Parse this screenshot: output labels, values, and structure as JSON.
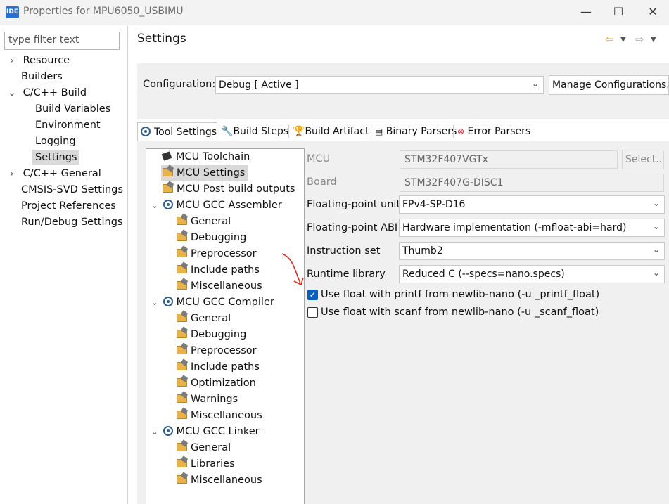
{
  "window": {
    "title": "Properties for MPU6050_USBIMU",
    "app_icon": "IDE",
    "minimize": "—",
    "maximize": "☐",
    "close": "✕"
  },
  "nav": {
    "filter_placeholder": "type filter text",
    "items": [
      {
        "label": "Resource"
      },
      {
        "label": "Builders"
      },
      {
        "label": "C/C++ Build"
      },
      {
        "label": "Build Variables"
      },
      {
        "label": "Environment"
      },
      {
        "label": "Logging"
      },
      {
        "label": "Settings"
      },
      {
        "label": "C/C++ General"
      },
      {
        "label": "CMSIS-SVD Settings"
      },
      {
        "label": "Project References"
      },
      {
        "label": "Run/Debug Settings"
      }
    ]
  },
  "page": {
    "title": "Settings"
  },
  "config": {
    "label": "Configuration:",
    "value": "Debug  [ Active ]",
    "manage_button": "Manage Configurations..."
  },
  "tabs": [
    "Tool Settings",
    "Build Steps",
    "Build Artifact",
    "Binary Parsers",
    "Error Parsers"
  ],
  "tree": {
    "toolchain": "MCU Toolchain",
    "mcu_settings": "MCU Settings",
    "post_build": "MCU Post build outputs",
    "assembler": {
      "label": "MCU GCC Assembler",
      "children": [
        "General",
        "Debugging",
        "Preprocessor",
        "Include paths",
        "Miscellaneous"
      ]
    },
    "compiler": {
      "label": "MCU GCC Compiler",
      "children": [
        "General",
        "Debugging",
        "Preprocessor",
        "Include paths",
        "Optimization",
        "Warnings",
        "Miscellaneous"
      ]
    },
    "linker": {
      "label": "MCU GCC Linker",
      "children": [
        "General",
        "Libraries",
        "Miscellaneous"
      ]
    }
  },
  "form": {
    "mcu_label": "MCU",
    "mcu_value": "STM32F407VGTx",
    "select_button": "Select...",
    "board_label": "Board",
    "board_value": "STM32F407G-DISC1",
    "fpu_label": "Floating-point unit",
    "fpu_value": "FPv4-SP-D16",
    "abi_label": "Floating-point ABI",
    "abi_value": "Hardware implementation (-mfloat-abi=hard)",
    "iset_label": "Instruction set",
    "iset_value": "Thumb2",
    "runtime_label": "Runtime library",
    "runtime_value": "Reduced C (--specs=nano.specs)",
    "printf_label": "Use float with printf from newlib-nano (-u _printf_float)",
    "printf_checked": true,
    "scanf_label": "Use float with scanf from newlib-nano (-u _scanf_float)",
    "scanf_checked": false
  },
  "colors": {
    "accent": "#0a5fbd",
    "annotation_arrow": "#d62d20",
    "nav_back": "#e8a81c"
  }
}
